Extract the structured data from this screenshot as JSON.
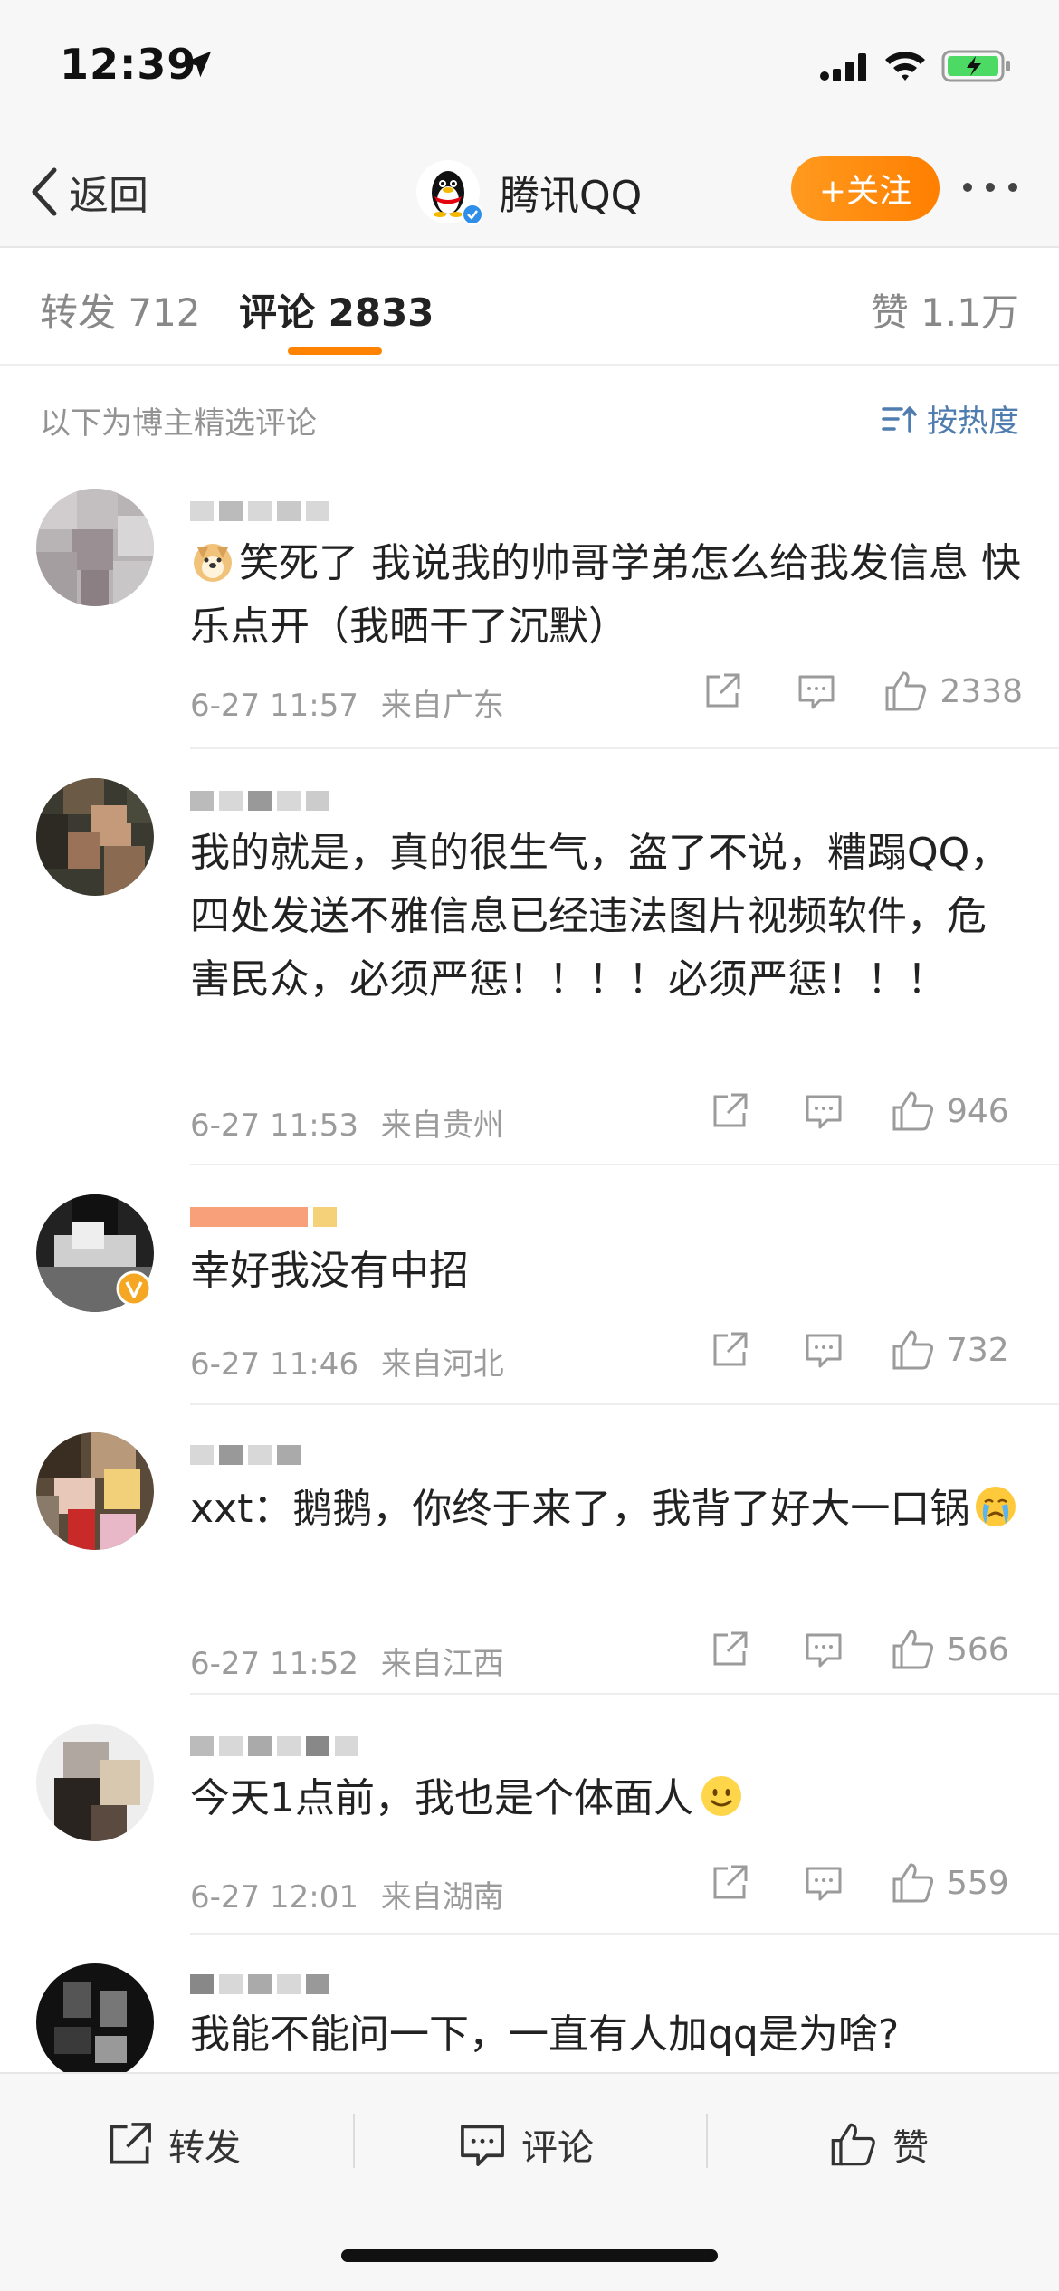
{
  "status_bar": {
    "time": "12:39"
  },
  "nav": {
    "back_label": "返回",
    "title": "腾讯QQ",
    "follow_label": "+关注"
  },
  "tabs": {
    "repost": "转发 712",
    "comments": "评论 2833",
    "likes": "赞 1.1万"
  },
  "section": {
    "label": "以下为博主精选评论",
    "sort_label": "按热度"
  },
  "comments": [
    {
      "text": "笑死了 我说我的帅哥学弟怎么给我发信息 快乐点开（我晒干了沉默）",
      "time": "6-27 11:57",
      "location": "来自广东",
      "likes": "2338",
      "emoji_prefix": "doge-emoji"
    },
    {
      "text": "我的就是，真的很生气，盗了不说，糟蹋QQ，四处发送不雅信息已经违法图片视频软件，危害民众，必须严惩！！！！必须严惩！！！",
      "time": "6-27 11:53",
      "location": "来自贵州",
      "likes": "946"
    },
    {
      "text": "幸好我没有中招",
      "time": "6-27 11:46",
      "location": "来自河北",
      "likes": "732"
    },
    {
      "text": "xxt：鹅鹅，你终于来了，我背了好大一口锅",
      "time": "6-27 11:52",
      "location": "来自江西",
      "likes": "566",
      "emoji_suffix": "crying-emoji"
    },
    {
      "text": "今天1点前，我也是个体面人",
      "time": "6-27 12:01",
      "location": "来自湖南",
      "likes": "559",
      "emoji_suffix": "smile-emoji"
    },
    {
      "text": "我能不能问一下，一直有人加qq是为啥?"
    }
  ],
  "bottom_bar": {
    "repost": "转发",
    "comment": "评论",
    "like": "赞"
  },
  "colors": {
    "accent_orange": "#ff8200",
    "link_blue": "#507daf",
    "meta_gray": "#9b9b9b"
  }
}
